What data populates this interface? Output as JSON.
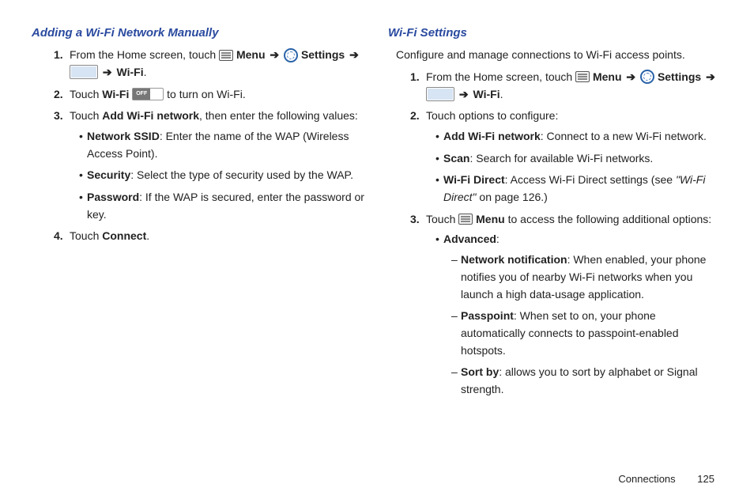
{
  "left": {
    "heading": "Adding a Wi-Fi Network Manually",
    "s1_a": "From the Home screen, touch ",
    "s1_menu": "Menu",
    "s1_settings": "Settings",
    "s1_wifi": "Wi-Fi",
    "s2_a": "Touch ",
    "s2_wifi": "Wi-Fi",
    "s2_b": " to turn on Wi-Fi.",
    "s3_a": "Touch ",
    "s3_bold": "Add Wi-Fi network",
    "s3_b": ", then enter the following values:",
    "b1_bold": "Network SSID",
    "b1_text": ": Enter the name of the WAP (Wireless Access Point).",
    "b2_bold": "Security",
    "b2_text": ": Select the type of security used by the WAP.",
    "b3_bold": "Password",
    "b3_text": ": If the WAP is secured, enter the password or key.",
    "s4_a": "Touch ",
    "s4_bold": "Connect",
    "s4_b": "."
  },
  "right": {
    "heading": "Wi-Fi Settings",
    "intro": "Configure and manage connections to Wi-Fi access points.",
    "s1_a": "From the Home screen, touch ",
    "s1_menu": "Menu",
    "s1_settings": "Settings",
    "s1_wifi": "Wi-Fi",
    "s2": "Touch options to configure:",
    "b1_bold": "Add Wi-Fi network",
    "b1_text": ": Connect to a new Wi-Fi network.",
    "b2_bold": "Scan",
    "b2_text": ": Search for available Wi-Fi networks.",
    "b3_bold": "Wi-Fi Direct",
    "b3_text_a": ": Access Wi-Fi Direct settings (see ",
    "b3_italic": "\"Wi-Fi Direct\"",
    "b3_text_b": " on page 126.)",
    "s3_a": "Touch ",
    "s3_menu": "Menu",
    "s3_b": " to access the following additional options:",
    "adv_bold": "Advanced",
    "adv_colon": ":",
    "d1_bold": "Network notification",
    "d1_text": ": When enabled, your phone notifies you of nearby Wi-Fi networks when you launch a high data-usage application.",
    "d2_bold": "Passpoint",
    "d2_text": ": When set to on, your phone automatically connects to passpoint-enabled hotspots.",
    "d3_bold": "Sort by",
    "d3_text": ": allows you to sort by alphabet or Signal strength."
  },
  "footer": {
    "section": "Connections",
    "page": "125"
  },
  "arrow": "➔"
}
